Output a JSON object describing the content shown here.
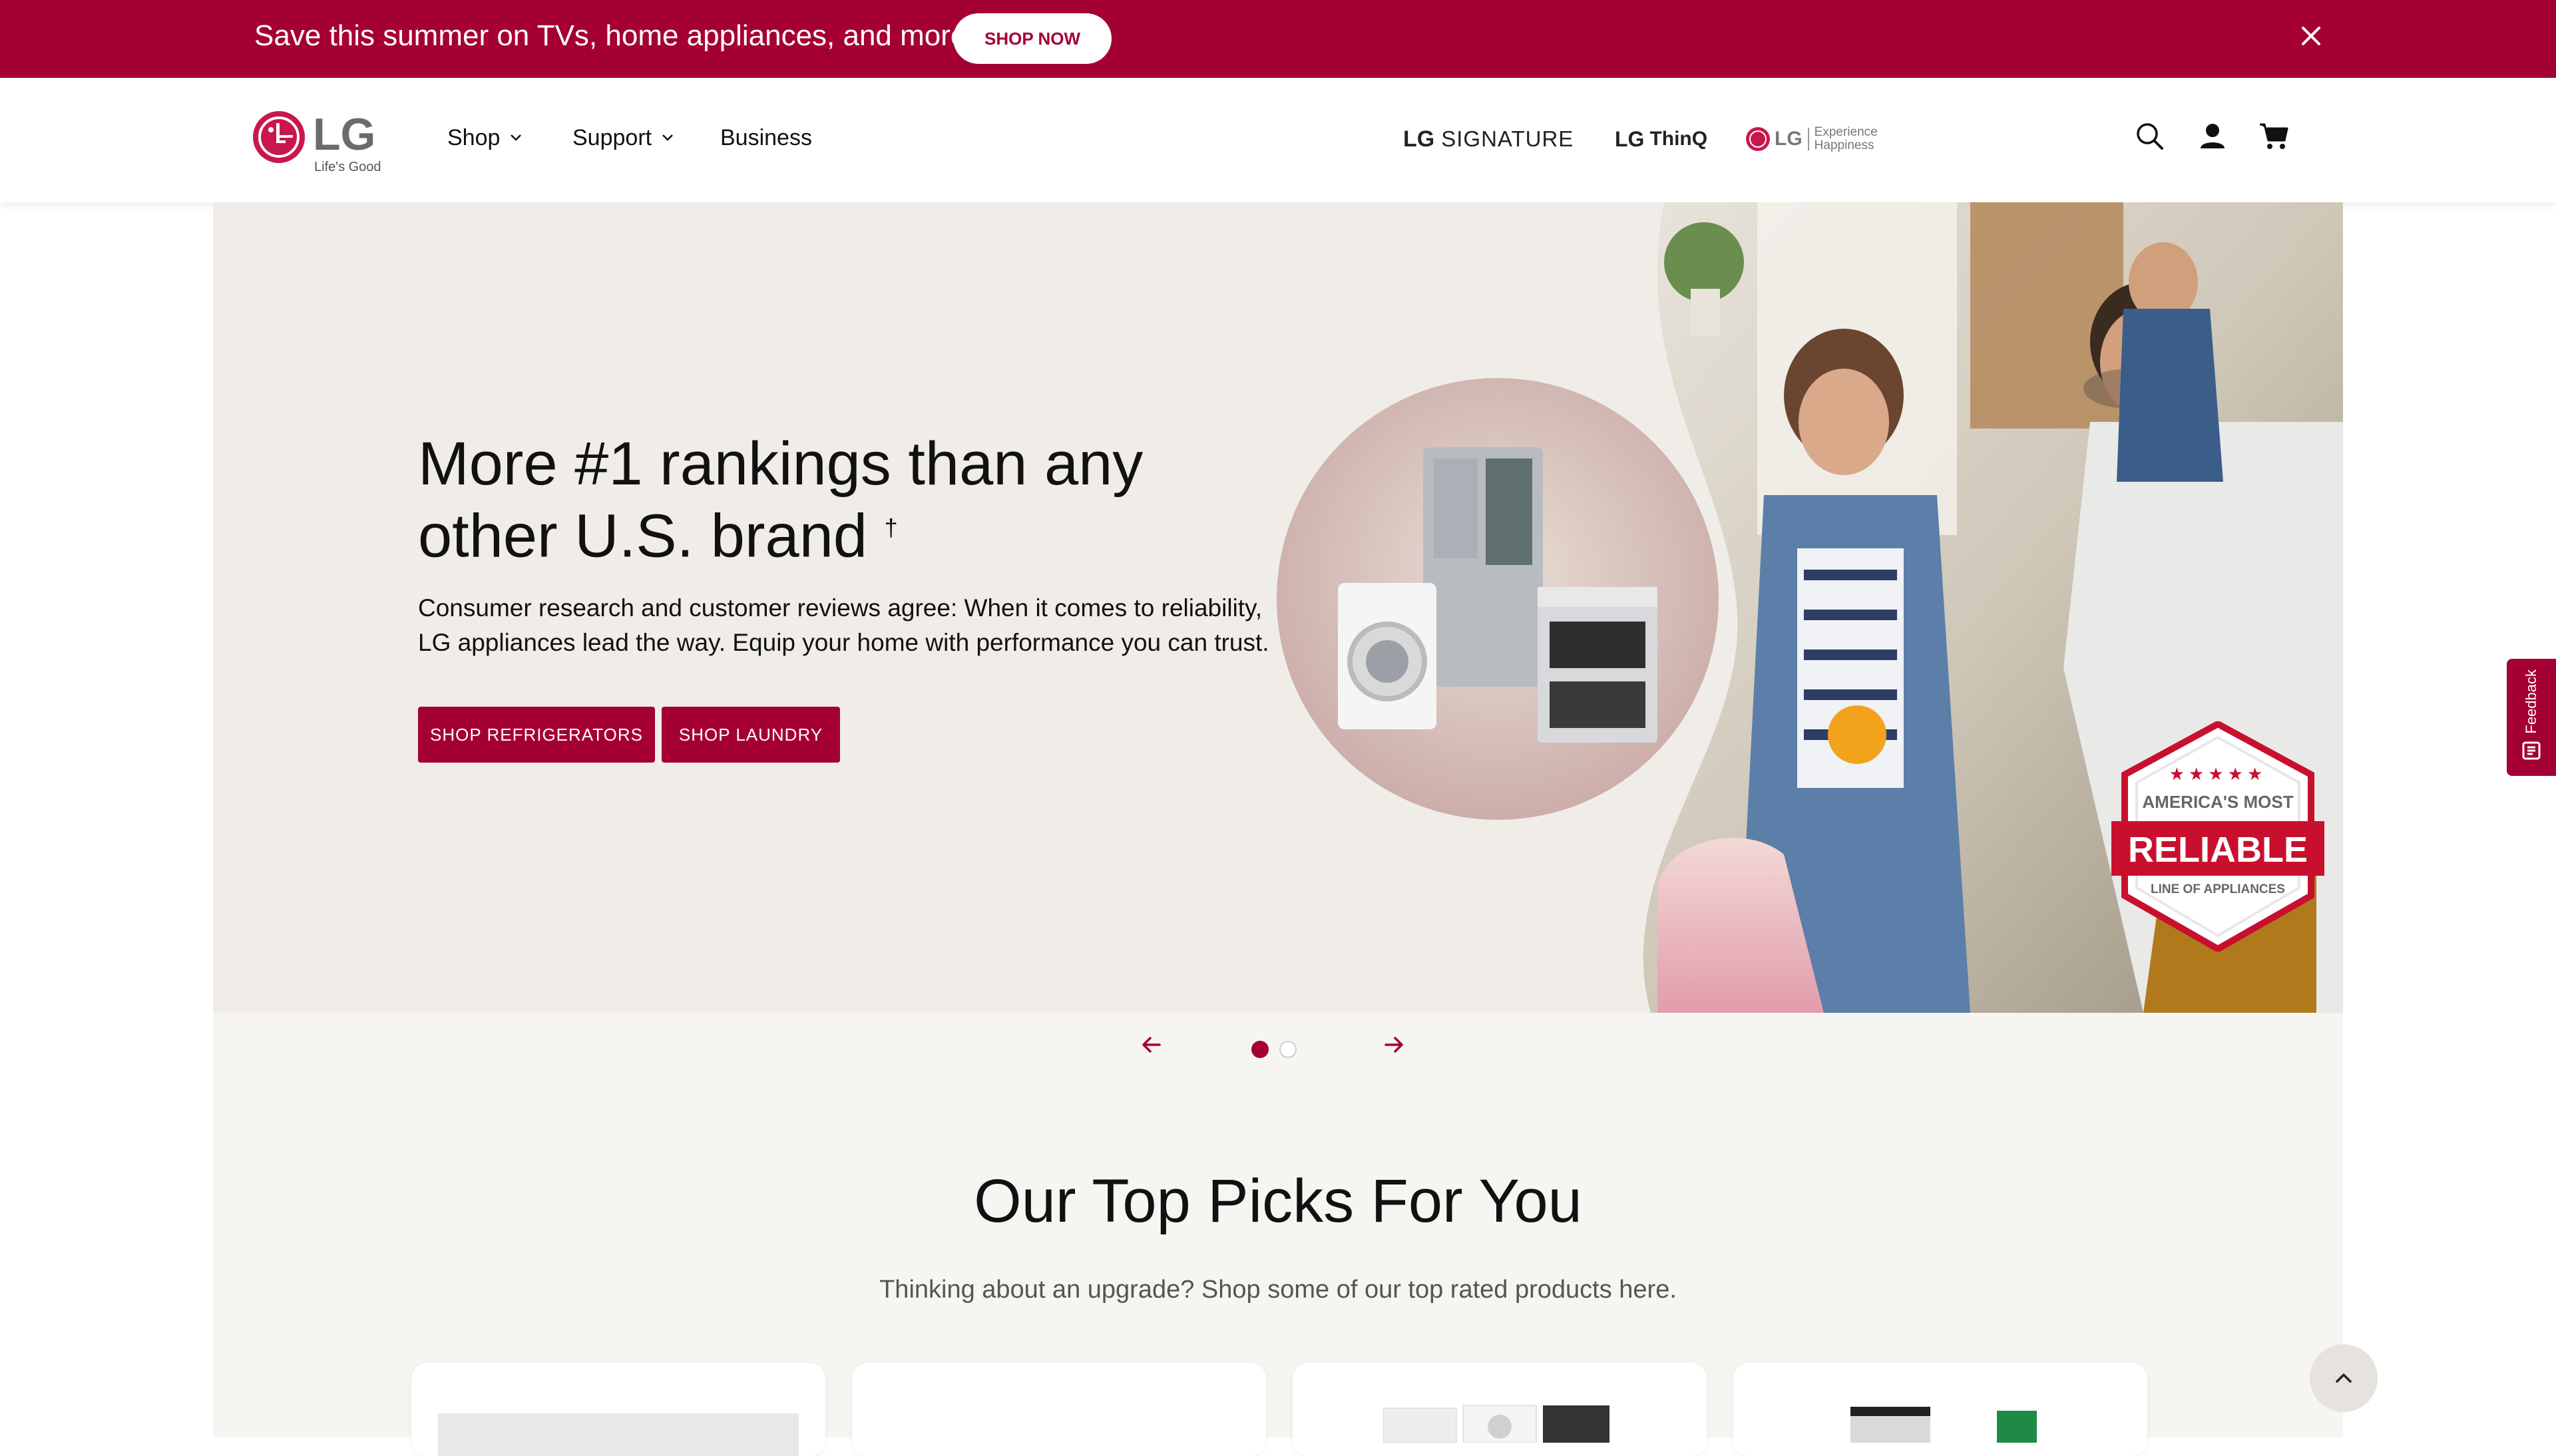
{
  "promo": {
    "text": "Save this summer on TVs, home appliances, and more",
    "cta": "SHOP NOW",
    "close_icon": "close-icon"
  },
  "header": {
    "logo_text": "LG",
    "logo_tagline": "Life's Good",
    "nav": [
      {
        "label": "Shop",
        "has_dropdown": true
      },
      {
        "label": "Support",
        "has_dropdown": true
      },
      {
        "label": "Business",
        "has_dropdown": false
      }
    ],
    "brands": {
      "signature_lg": "LG",
      "signature": "SIGNATURE",
      "thinq_lg": "LG",
      "thinq": "ThinQ",
      "experience_lg": "LG",
      "experience_1": "Experience",
      "experience_2": "Happiness"
    },
    "icons": [
      "search-icon",
      "account-icon",
      "cart-icon"
    ]
  },
  "hero": {
    "title": "More #1 rankings than any other U.S. brand",
    "title_mark": "†",
    "body": "Consumer research and customer reviews agree: When it comes to reliability, LG appliances lead the way. Equip your home with performance you can trust.",
    "buttons": [
      "SHOP REFRIGERATORS",
      "SHOP LAUNDRY"
    ],
    "badge": {
      "stars": "★★★★★",
      "line1": "AMERICA'S MOST",
      "line2": "RELIABLE",
      "line3": "LINE OF APPLIANCES"
    }
  },
  "carousel": {
    "slides": 2,
    "active": 1,
    "prev_icon": "arrow-left-icon",
    "next_icon": "arrow-right-icon"
  },
  "top_picks": {
    "title": "Our Top Picks For You",
    "subtitle": "Thinking about an upgrade? Shop some of our top rated products here."
  },
  "feedback": {
    "label": "Feedback"
  },
  "colors": {
    "brand": "#a50034",
    "hero_bg": "#f0ede8",
    "page_bg": "#f7f5f2"
  }
}
